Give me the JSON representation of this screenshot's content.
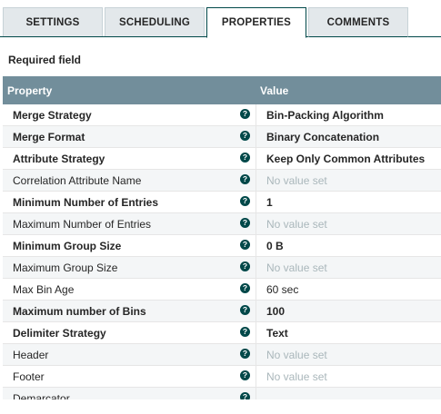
{
  "tabs": [
    {
      "label": "SETTINGS",
      "active": false
    },
    {
      "label": "SCHEDULING",
      "active": false
    },
    {
      "label": "PROPERTIES",
      "active": true
    },
    {
      "label": "COMMENTS",
      "active": false
    }
  ],
  "required_label": "Required field",
  "table": {
    "header_property": "Property",
    "header_value": "Value",
    "help_glyph": "?",
    "rows": [
      {
        "name": "Merge Strategy",
        "value": "Bin-Packing Algorithm",
        "required": true,
        "unset": false
      },
      {
        "name": "Merge Format",
        "value": "Binary Concatenation",
        "required": true,
        "unset": false
      },
      {
        "name": "Attribute Strategy",
        "value": "Keep Only Common Attributes",
        "required": true,
        "unset": false
      },
      {
        "name": "Correlation Attribute Name",
        "value": "No value set",
        "required": false,
        "unset": true
      },
      {
        "name": "Minimum Number of Entries",
        "value": "1",
        "required": true,
        "unset": false
      },
      {
        "name": "Maximum Number of Entries",
        "value": "No value set",
        "required": false,
        "unset": true
      },
      {
        "name": "Minimum Group Size",
        "value": "0 B",
        "required": true,
        "unset": false
      },
      {
        "name": "Maximum Group Size",
        "value": "No value set",
        "required": false,
        "unset": true
      },
      {
        "name": "Max Bin Age",
        "value": "60 sec",
        "required": false,
        "unset": false
      },
      {
        "name": "Maximum number of Bins",
        "value": "100",
        "required": true,
        "unset": false
      },
      {
        "name": "Delimiter Strategy",
        "value": "Text",
        "required": true,
        "unset": false
      },
      {
        "name": "Header",
        "value": "No value set",
        "required": false,
        "unset": true
      },
      {
        "name": "Footer",
        "value": "No value set",
        "required": false,
        "unset": true
      },
      {
        "name": "Demarcator",
        "value": "",
        "required": false,
        "unset": false
      }
    ]
  },
  "colors": {
    "header_bg": "#728e9b",
    "help_icon": "#004849",
    "tab_bg": "#e3e8eb",
    "unset_text": "#aab7bb"
  }
}
